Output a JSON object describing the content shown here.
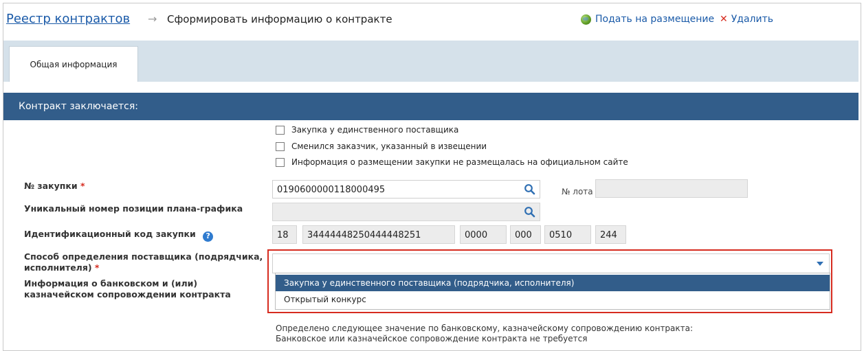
{
  "header": {
    "breadcrumb_link": "Реестр контрактов",
    "breadcrumb_arrow": "→",
    "page_title": "Сформировать информацию о контракте",
    "publish_label": "Подать на размещение",
    "delete_label": "Удалить"
  },
  "tabs": [
    {
      "label": "Общая информация",
      "active": true
    }
  ],
  "section": {
    "title": "Контракт заключается:"
  },
  "checkboxes": [
    {
      "label": "Закупка у единственного поставщика",
      "checked": false
    },
    {
      "label": "Сменился заказчик, указанный в извещении",
      "checked": false
    },
    {
      "label": "Информация о размещении закупки не размещалась на официальном сайте",
      "checked": false
    }
  ],
  "form": {
    "purchase_number": {
      "label": "№ закупки",
      "value": "0190600000118000495"
    },
    "lot_number": {
      "label": "№ лота",
      "value": ""
    },
    "plan_position": {
      "label": "Уникальный номер позиции плана-графика",
      "value": ""
    },
    "ident_code": {
      "label": "Идентификационный код закупки",
      "help": "?",
      "parts": [
        "18",
        "34444448250444448251",
        "0000",
        "000",
        "0510",
        "244"
      ]
    },
    "supplier_method": {
      "label_line1": "Способ определения поставщика (подрядчика,",
      "label_line2": "исполнителя)",
      "value": "",
      "options": [
        "Закупка у единственного поставщика (подрядчика, исполнителя)",
        "Открытый конкурс"
      ]
    },
    "bank_info": {
      "label_line1": "Информация о банковском и (или)",
      "label_line2": "казначейском сопровождении контракта"
    },
    "required_mark": "*"
  },
  "notes": [
    "Определено следующее значение по банковскому, казначейскому сопровождению контракта:",
    "Банковское или казначейское сопровождение контракта не требуется"
  ],
  "colors": {
    "link": "#1a5aa8",
    "band": "#325d8a",
    "required": "#d62b1f",
    "highlight_border": "#d62b1f"
  }
}
